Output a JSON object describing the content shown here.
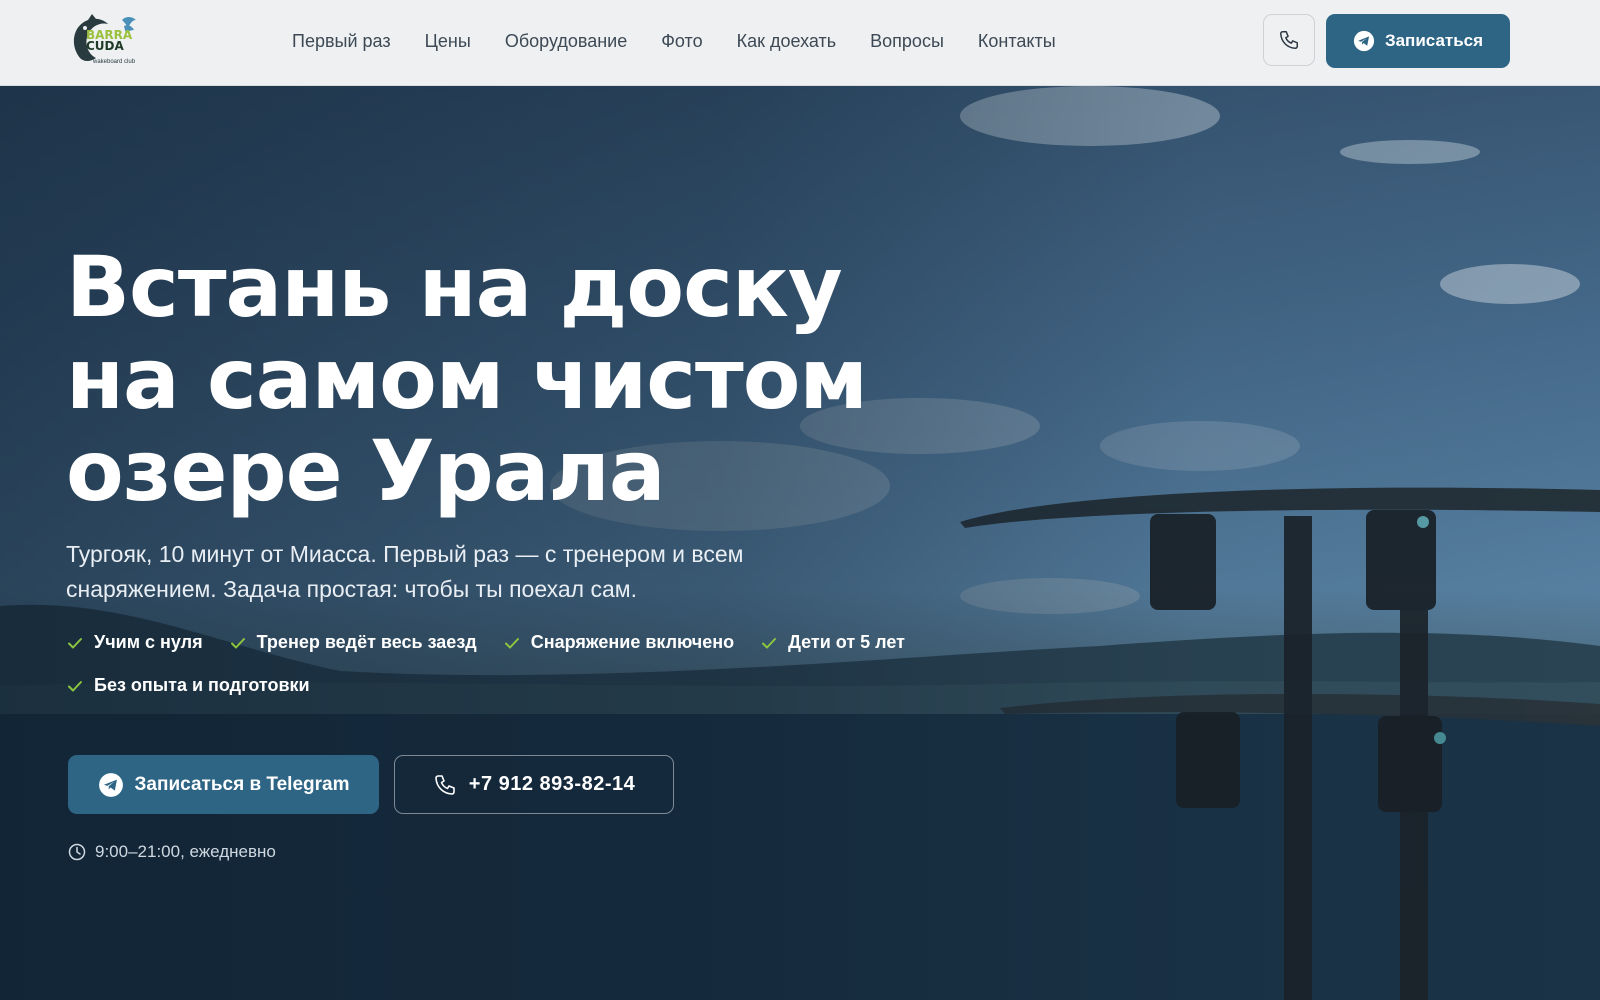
{
  "brand": {
    "logo_line1": "BARRA",
    "logo_line2": "CUDA",
    "logo_sub": "wakeboard club"
  },
  "nav": {
    "items": [
      "Первый раз",
      "Цены",
      "Оборудование",
      "Фото",
      "Как доехать",
      "Вопросы",
      "Контакты"
    ]
  },
  "header": {
    "phone_icon": "phone-icon",
    "cta_label": "Записаться"
  },
  "hero": {
    "headline": [
      "Встань на доску",
      "на самом чистом",
      "озере Урала"
    ],
    "subtitle": "Тургояк, 10 минут от Миасса. Первый раз — с тренером и всем снаряжением. Задача простая: чтобы ты поехал сам.",
    "features": [
      "Учим с нуля",
      "Тренер ведёт весь заезд",
      "Снаряжение включено",
      "Дети от 5 лет",
      "Без опыта и подготовки"
    ],
    "cta_telegram": "Записаться в Telegram",
    "cta_phone": "+7 912 893-82-14",
    "hours": "9:00–21:00, ежедневно"
  },
  "colors": {
    "accent": "#2e6585",
    "check": "#8cc63f",
    "header_bg": "#eef0f2",
    "nav_text": "#3d4954"
  }
}
